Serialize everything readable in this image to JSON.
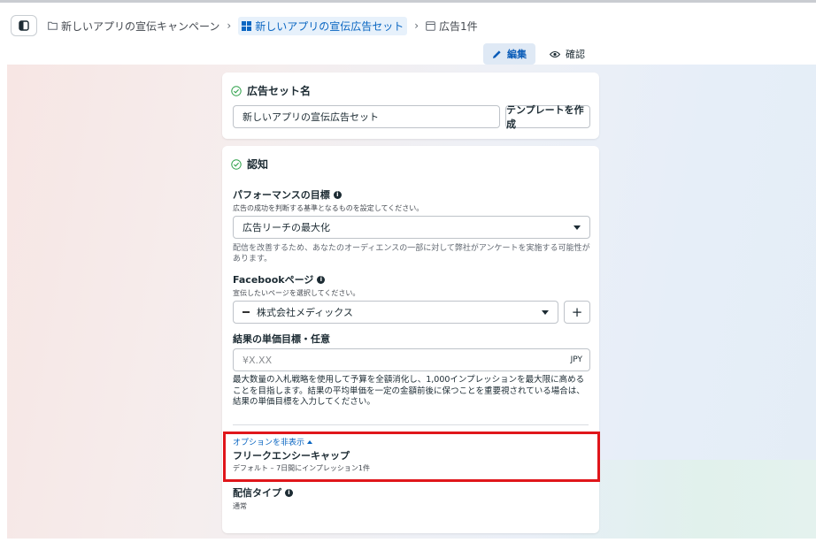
{
  "breadcrumb": {
    "campaign": "新しいアプリの宣伝キャンペーン",
    "adset": "新しいアプリの宣伝広告セット",
    "ad": "広告1件"
  },
  "mode_tabs": {
    "edit": "編集",
    "review": "確認"
  },
  "adset_name_section": {
    "title": "広告セット名",
    "name_value": "新しいアプリの宣伝広告セット",
    "template_button": "テンプレートを作成"
  },
  "awareness_section": {
    "title": "認知",
    "performance_goal": {
      "label": "パフォーマンスの目標",
      "description": "広告の成功を判断する基準となるものを設定してください。",
      "selected": "広告リーチの最大化",
      "note": "配信を改善するため、あなたのオーディエンスの一部に対して弊社がアンケートを実施する可能性があります。"
    },
    "facebook_page": {
      "label": "Facebookページ",
      "description": "宣伝したいページを選択してください。",
      "selected": "株式会社メディックス",
      "add_button": "+"
    },
    "cost_per_result": {
      "label": "結果の単価目標・任意",
      "placeholder": "¥X.XX",
      "currency": "JPY",
      "help": "最大数量の入札戦略を使用して予算を全額消化し、1,000インプレッションを最大限に高めることを目指します。結果の平均単価を一定の金額前後に保つことを重要視されている場合は、結果の単価目標を入力してください。"
    },
    "options_toggle": "オプションを非表示",
    "frequency_cap": {
      "label": "フリークエンシーキャップ",
      "value": "デフォルト – 7日間にインプレッション1件"
    },
    "delivery_type": {
      "label": "配信タイプ",
      "value": "通常"
    }
  },
  "colors": {
    "highlight": "#e0161b",
    "link": "#0a66c2",
    "active_tab": "#dfe9f5"
  }
}
